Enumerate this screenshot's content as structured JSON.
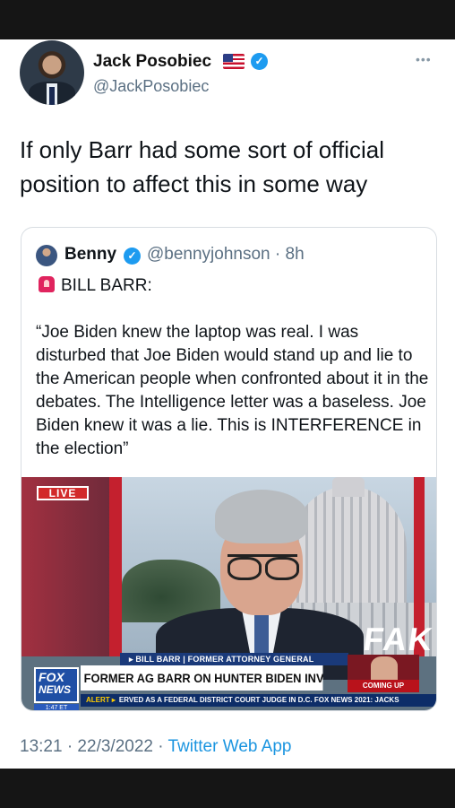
{
  "author": {
    "name": "Jack Posobiec",
    "handle": "@JackPosobiec",
    "flag_icon": "us-flag-icon",
    "verified_icon": "verified-badge-icon"
  },
  "more_icon": "more-options-icon",
  "tweet_text": "If only Barr had some sort of official position to affect this in some way",
  "quote": {
    "name": "Benny",
    "handle": "@bennyjohnson · 8h",
    "label": "BILL BARR:",
    "label_icon": "siren-icon",
    "body": "“Joe Biden knew the laptop was real. I was disturbed that Joe Biden would stand up and lie to the American people when confronted about it in the debates. The Intelligence letter was a baseless. Joe Biden knew it was a lie. This is INTERFERENCE in the election”",
    "media": {
      "live_badge": "LIVE",
      "backdrop_text": "FAK",
      "lower_third_label": "▸ BILL BARR | FORMER ATTORNEY GENERAL",
      "logo_line1": "FOX",
      "logo_line2": "NEWS",
      "time": "1:47 ET",
      "headline": "FORMER AG BARR ON HUNTER BIDEN INVESTIGATION",
      "promo_text": "COMING UP",
      "alert_label": "ALERT ▸",
      "ticker": "ERVED AS A FEDERAL DISTRICT COURT JUDGE IN D.C.   FOX NEWS 2021: JACKS"
    }
  },
  "footer": {
    "timestamp": "13:21 · 22/3/2022 · ",
    "app": "Twitter Web App"
  },
  "colors": {
    "link_blue": "#1b95e0",
    "verified_blue": "#1d9bf0",
    "secondary_text": "#5b7083"
  }
}
